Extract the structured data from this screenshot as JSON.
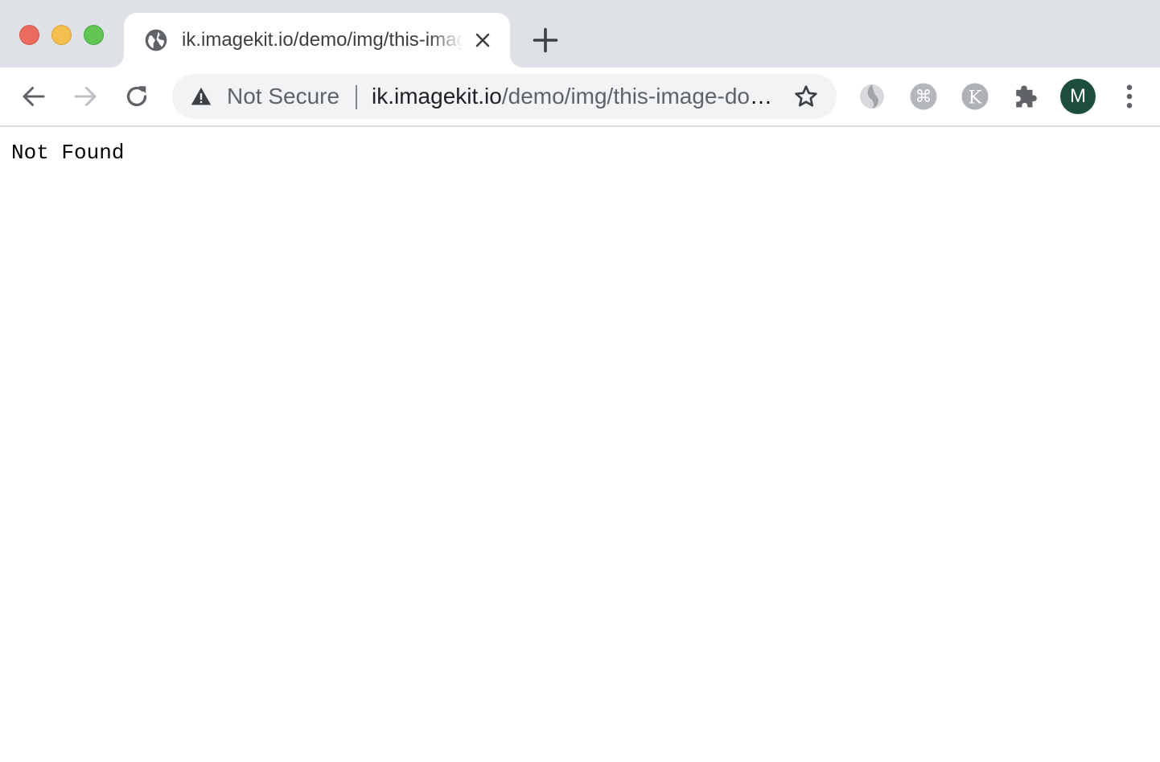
{
  "colors": {
    "tabstrip_bg": "#dee1e6",
    "traffic_close": "#ed6a5e",
    "traffic_minimize": "#f5bf4f",
    "traffic_maximize": "#61c554",
    "icon_gray": "#5f6368",
    "icon_disabled": "#bdc1c6",
    "omnibox_bg": "#f1f3f4",
    "avatar_bg": "#1d4d3c"
  },
  "window": {
    "traffic_lights": [
      "close",
      "minimize",
      "maximize"
    ]
  },
  "tab": {
    "favicon": "globe-icon",
    "title": "ik.imagekit.io/demo/img/this-image-does-not-exist",
    "close_icon": "close-icon"
  },
  "toolbar": {
    "back_icon": "back-arrow-icon",
    "forward_icon": "forward-arrow-icon",
    "reload_icon": "reload-icon",
    "new_tab_icon": "plus-icon"
  },
  "omnibox": {
    "security_icon": "warning-triangle-icon",
    "security_label": "Not Secure",
    "url_host": "ik.imagekit.io",
    "url_path": "/demo/img/this-image-does-not-exist",
    "bookmark_icon": "star-icon"
  },
  "extensions": [
    {
      "name": "extension-swirl-icon"
    },
    {
      "name": "extension-command-icon"
    },
    {
      "name": "extension-k-icon",
      "letter": "K"
    },
    {
      "name": "extensions-puzzle-icon"
    }
  ],
  "profile": {
    "initial": "M"
  },
  "menu": {
    "icon": "kebab-menu-icon"
  },
  "page": {
    "text": "Not Found"
  }
}
